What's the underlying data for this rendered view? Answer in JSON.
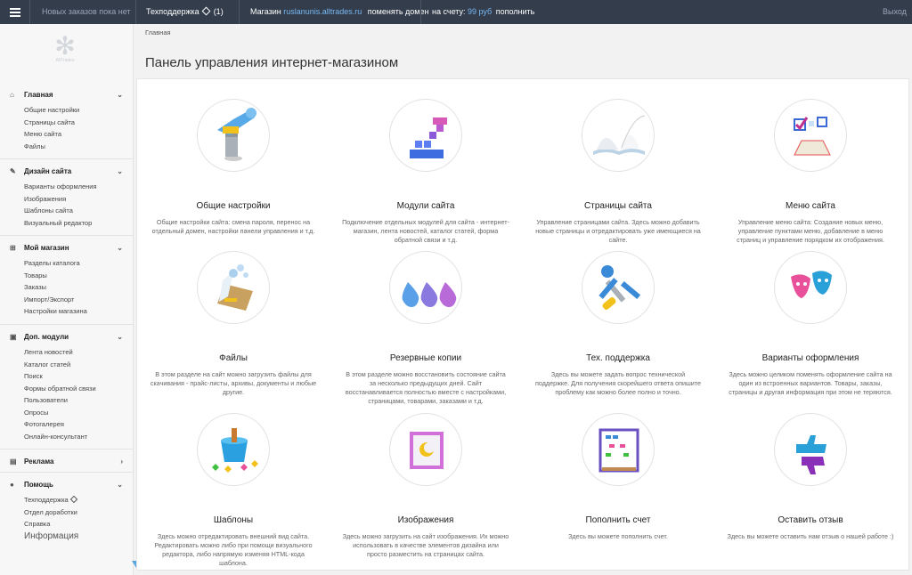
{
  "topbar": {
    "orders_status": "Новых заказов пока нет",
    "support_label": "Техподдержка",
    "support_count": "(1)",
    "shop_label": "Магазин",
    "shop_domain": "ruslanunis.alltrades.ru",
    "change_domain": "поменять домен",
    "balance_label": "на счету:",
    "balance_value": "99 руб",
    "topup_label": "пополнить",
    "logout": "Выход"
  },
  "sidebar": {
    "logo_text": "AllTrades",
    "sections": [
      {
        "title": "Главная",
        "icon": "home-icon",
        "items": [
          "Общие настройки",
          "Страницы сайта",
          "Меню сайта",
          "Файлы"
        ]
      },
      {
        "title": "Дизайн сайта",
        "icon": "brush-icon",
        "items": [
          "Варианты оформления",
          "Изображения",
          "Шаблоны сайта",
          "Визуальный редактор"
        ]
      },
      {
        "title": "Мой магазин",
        "icon": "cart-icon",
        "items": [
          "Разделы каталога",
          "Товары",
          "Заказы",
          "Импорт/Экспорт",
          "Настройки магазина"
        ]
      },
      {
        "title": "Доп. модули",
        "icon": "cubes-icon",
        "items": [
          "Лента новостей",
          "Каталог статей",
          "Поиск",
          "Формы обратной связи",
          "Пользователи",
          "Опросы",
          "Фотогалерея",
          "Онлайн-консультант"
        ]
      },
      {
        "title": "Реклама",
        "icon": "chart-icon",
        "items": []
      },
      {
        "title": "Помощь",
        "icon": "help-icon",
        "items": [
          "Техподдержка",
          "Отдел доработки",
          "Справка"
        ]
      }
    ],
    "info_label": "Информация"
  },
  "breadcrumb": "Главная",
  "page_title": "Панель управления интернет-магазином",
  "tiles": [
    {
      "title": "Общие настройки",
      "icon": "wrench-icon",
      "desc": "Общие настройки сайта: смена пароля, перенос на отдельный домен, настройки панели управления и т.д."
    },
    {
      "title": "Модули сайта",
      "icon": "blocks-icon",
      "desc": "Подключение отдельных модулей для сайта - интернет-магазин, лента новостей, каталог статей, форма обратной связи и т.д."
    },
    {
      "title": "Страницы сайта",
      "icon": "open-book-icon",
      "desc": "Управление страницами сайта. Здесь можно добавить новые страницы и отредактировать уже имеющиеся на сайте."
    },
    {
      "title": "Меню сайта",
      "icon": "checklist-icon",
      "desc": "Управление меню сайта: Создание новых меню, управление пунктами меню, добавление в меню страниц и управление порядком их отображения."
    },
    {
      "title": "Файлы",
      "icon": "folder-icon",
      "desc": "В этом разделе на сайт можно загрузить файлы для скачивания - прайс-листы, архивы, документы и любые другие."
    },
    {
      "title": "Резервные копии",
      "icon": "drops-icon",
      "desc": "В этом разделе можно восстановить состояние сайта за несколько предыдущих дней. Сайт восстанавливается полностью вместе с настройками, страницами, товарами, заказами и т.д."
    },
    {
      "title": "Тех. поддержка",
      "icon": "tools-icon",
      "desc": "Здесь вы можете задать вопрос технической поддержке. Для получения скорейшего ответа опишите проблему как можно более полно и точно."
    },
    {
      "title": "Варианты оформления",
      "icon": "masks-icon",
      "desc": "Здесь можно целиком поменять оформление сайта на один из встроенных вариантов. Товары, заказы, страницы и другая информация при этом не теряются."
    },
    {
      "title": "Шаблоны",
      "icon": "bucket-icon",
      "desc": "Здесь можно отредактировать внешний вид сайта. Редактировать можно либо при помощи визуального редактора, либо напрямую изменяя HTML-кода шаблона."
    },
    {
      "title": "Изображения",
      "icon": "picture-icon",
      "desc": "Здесь можно загрузить на сайт изображения. Их можно использовать в качестве элементов дизайна или просто разместить на страницах сайта."
    },
    {
      "title": "Пополнить счет",
      "icon": "abacus-icon",
      "desc": "Здесь вы можете пополнить счет."
    },
    {
      "title": "Оставить отзыв",
      "icon": "thumbs-icon",
      "desc": "Здесь вы можете оставить нам отзыв о нашей работе :)"
    }
  ]
}
